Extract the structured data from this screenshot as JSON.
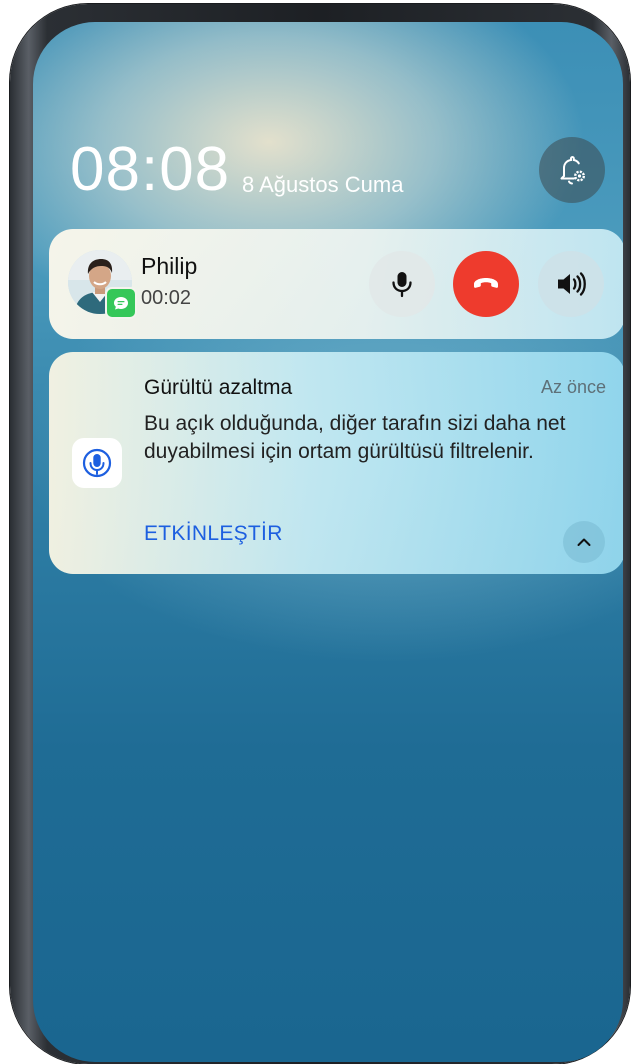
{
  "lockscreen": {
    "time": "08:08",
    "date": "8 Ağustos Cuma",
    "notification_settings_icon": "bell-gear-icon"
  },
  "call": {
    "caller_name": "Philip",
    "duration": "00:02",
    "badge_icon": "message-icon",
    "mute_icon": "microphone-icon",
    "end_icon": "phone-hangup-icon",
    "speaker_icon": "speaker-icon",
    "end_button_color": "#ee3b2d"
  },
  "notification": {
    "title": "Gürültü azaltma",
    "time": "Az önce",
    "body": "Bu açık olduğunda, diğer tarafın sizi daha net duyabilmesi için ortam gürültüsü filtrelenir.",
    "action_label": "ETKİNLEŞTİR",
    "action_color": "#1d5fe0",
    "app_icon": "microphone-icon",
    "collapse_icon": "chevron-up-icon"
  }
}
